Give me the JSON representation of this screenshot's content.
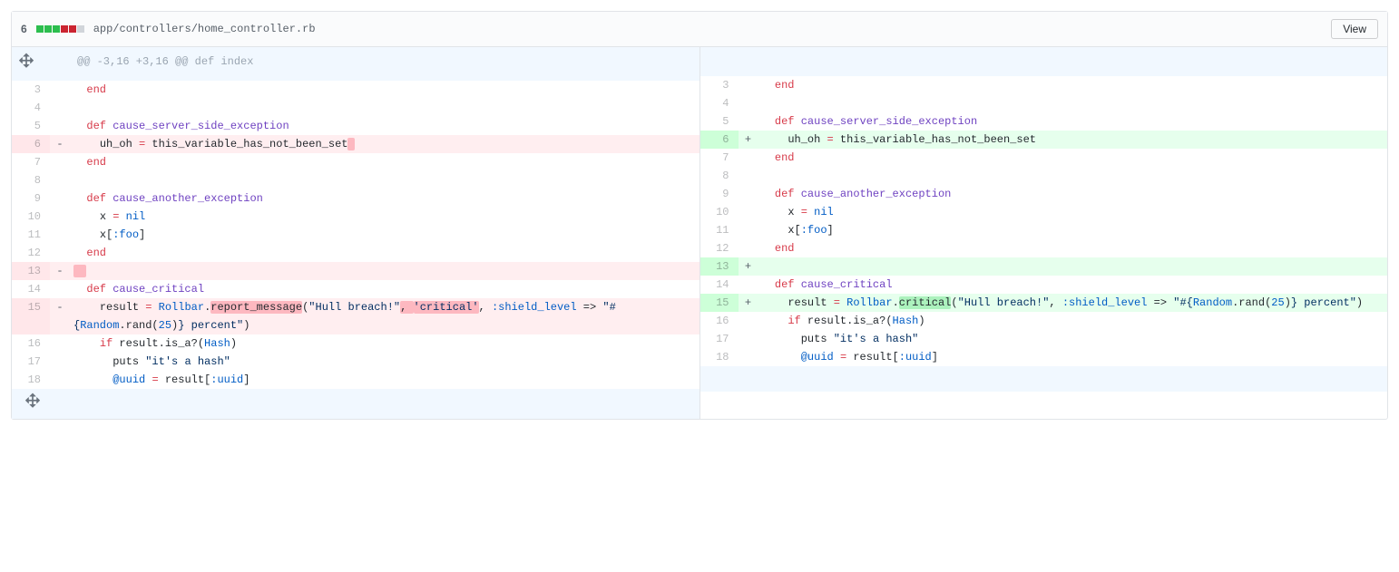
{
  "header": {
    "changed_count": "6",
    "file_path": "app/controllers/home_controller.rb",
    "view_label": "View",
    "diffstat": [
      "a",
      "a",
      "a",
      "d",
      "d",
      "n"
    ]
  },
  "hunk_header": "@@ -3,16 +3,16 @@ def index",
  "left": [
    {
      "n": "3",
      "sign": "",
      "type": "ctx",
      "tokens": [
        {
          "t": "  ",
          "c": ""
        },
        {
          "t": "end",
          "c": "tok-kw"
        }
      ]
    },
    {
      "n": "4",
      "sign": "",
      "type": "ctx",
      "tokens": []
    },
    {
      "n": "5",
      "sign": "",
      "type": "ctx",
      "tokens": [
        {
          "t": "  ",
          "c": ""
        },
        {
          "t": "def",
          "c": "tok-kw"
        },
        {
          "t": " ",
          "c": ""
        },
        {
          "t": "cause_server_side_exception",
          "c": "tok-fn"
        }
      ]
    },
    {
      "n": "6",
      "sign": "-",
      "type": "del",
      "tokens": [
        {
          "t": "    uh_oh ",
          "c": ""
        },
        {
          "t": "=",
          "c": "tok-kw"
        },
        {
          "t": " this_variable_has_not_been_set",
          "c": ""
        },
        {
          "t": " ",
          "c": "mark-del"
        }
      ]
    },
    {
      "n": "7",
      "sign": "",
      "type": "ctx",
      "tokens": [
        {
          "t": "  ",
          "c": ""
        },
        {
          "t": "end",
          "c": "tok-kw"
        }
      ]
    },
    {
      "n": "8",
      "sign": "",
      "type": "ctx",
      "tokens": []
    },
    {
      "n": "9",
      "sign": "",
      "type": "ctx",
      "tokens": [
        {
          "t": "  ",
          "c": ""
        },
        {
          "t": "def",
          "c": "tok-kw"
        },
        {
          "t": " ",
          "c": ""
        },
        {
          "t": "cause_another_exception",
          "c": "tok-fn"
        }
      ]
    },
    {
      "n": "10",
      "sign": "",
      "type": "ctx",
      "tokens": [
        {
          "t": "    x ",
          "c": ""
        },
        {
          "t": "=",
          "c": "tok-kw"
        },
        {
          "t": " ",
          "c": ""
        },
        {
          "t": "nil",
          "c": "tok-num"
        }
      ]
    },
    {
      "n": "11",
      "sign": "",
      "type": "ctx",
      "tokens": [
        {
          "t": "    x[",
          "c": ""
        },
        {
          "t": ":foo",
          "c": "tok-sym"
        },
        {
          "t": "]",
          "c": ""
        }
      ]
    },
    {
      "n": "12",
      "sign": "",
      "type": "ctx",
      "tokens": [
        {
          "t": "  ",
          "c": ""
        },
        {
          "t": "end",
          "c": "tok-kw"
        }
      ]
    },
    {
      "n": "13",
      "sign": "-",
      "type": "del",
      "tokens": [
        {
          "t": "  ",
          "c": "mark-del"
        }
      ]
    },
    {
      "n": "14",
      "sign": "",
      "type": "ctx",
      "tokens": [
        {
          "t": "  ",
          "c": ""
        },
        {
          "t": "def",
          "c": "tok-kw"
        },
        {
          "t": " ",
          "c": ""
        },
        {
          "t": "cause_critical",
          "c": "tok-fn"
        }
      ]
    },
    {
      "n": "15",
      "sign": "-",
      "type": "del",
      "tokens": [
        {
          "t": "    result ",
          "c": ""
        },
        {
          "t": "=",
          "c": "tok-kw"
        },
        {
          "t": " ",
          "c": ""
        },
        {
          "t": "Rollbar",
          "c": "tok-const"
        },
        {
          "t": ".",
          "c": ""
        },
        {
          "t": "report_message",
          "c": "mark-del"
        },
        {
          "t": "(",
          "c": ""
        },
        {
          "t": "\"Hull breach!\"",
          "c": "tok-str"
        },
        {
          "t": ", ",
          "c": "mark-del"
        },
        {
          "t": "'critical'",
          "c": "tok-str mark-del"
        },
        {
          "t": ", ",
          "c": ""
        },
        {
          "t": ":shield_level",
          "c": "tok-sym"
        },
        {
          "t": " => ",
          "c": ""
        },
        {
          "t": "\"#{",
          "c": "tok-str"
        },
        {
          "t": "Random",
          "c": "tok-const"
        },
        {
          "t": ".rand(",
          "c": ""
        },
        {
          "t": "25",
          "c": "tok-num"
        },
        {
          "t": ")",
          "c": ""
        },
        {
          "t": "} percent\"",
          "c": "tok-str"
        },
        {
          "t": ")",
          "c": ""
        }
      ]
    },
    {
      "n": "16",
      "sign": "",
      "type": "ctx",
      "tokens": [
        {
          "t": "    ",
          "c": ""
        },
        {
          "t": "if",
          "c": "tok-kw"
        },
        {
          "t": " result.is_a?(",
          "c": ""
        },
        {
          "t": "Hash",
          "c": "tok-const"
        },
        {
          "t": ")",
          "c": ""
        }
      ]
    },
    {
      "n": "17",
      "sign": "",
      "type": "ctx",
      "tokens": [
        {
          "t": "      puts ",
          "c": ""
        },
        {
          "t": "\"it's a hash\"",
          "c": "tok-str"
        }
      ]
    },
    {
      "n": "18",
      "sign": "",
      "type": "ctx",
      "tokens": [
        {
          "t": "      ",
          "c": ""
        },
        {
          "t": "@uuid",
          "c": "tok-num"
        },
        {
          "t": " ",
          "c": ""
        },
        {
          "t": "=",
          "c": "tok-kw"
        },
        {
          "t": " result[",
          "c": ""
        },
        {
          "t": ":uuid",
          "c": "tok-sym"
        },
        {
          "t": "]",
          "c": ""
        }
      ]
    }
  ],
  "right": [
    {
      "n": "3",
      "sign": "",
      "type": "ctx",
      "tokens": [
        {
          "t": "  ",
          "c": ""
        },
        {
          "t": "end",
          "c": "tok-kw"
        }
      ]
    },
    {
      "n": "4",
      "sign": "",
      "type": "ctx",
      "tokens": []
    },
    {
      "n": "5",
      "sign": "",
      "type": "ctx",
      "tokens": [
        {
          "t": "  ",
          "c": ""
        },
        {
          "t": "def",
          "c": "tok-kw"
        },
        {
          "t": " ",
          "c": ""
        },
        {
          "t": "cause_server_side_exception",
          "c": "tok-fn"
        }
      ]
    },
    {
      "n": "6",
      "sign": "+",
      "type": "add",
      "tokens": [
        {
          "t": "    uh_oh ",
          "c": ""
        },
        {
          "t": "=",
          "c": "tok-kw"
        },
        {
          "t": " this_variable_has_not_been_set",
          "c": ""
        }
      ]
    },
    {
      "n": "7",
      "sign": "",
      "type": "ctx",
      "tokens": [
        {
          "t": "  ",
          "c": ""
        },
        {
          "t": "end",
          "c": "tok-kw"
        }
      ]
    },
    {
      "n": "8",
      "sign": "",
      "type": "ctx",
      "tokens": []
    },
    {
      "n": "9",
      "sign": "",
      "type": "ctx",
      "tokens": [
        {
          "t": "  ",
          "c": ""
        },
        {
          "t": "def",
          "c": "tok-kw"
        },
        {
          "t": " ",
          "c": ""
        },
        {
          "t": "cause_another_exception",
          "c": "tok-fn"
        }
      ]
    },
    {
      "n": "10",
      "sign": "",
      "type": "ctx",
      "tokens": [
        {
          "t": "    x ",
          "c": ""
        },
        {
          "t": "=",
          "c": "tok-kw"
        },
        {
          "t": " ",
          "c": ""
        },
        {
          "t": "nil",
          "c": "tok-num"
        }
      ]
    },
    {
      "n": "11",
      "sign": "",
      "type": "ctx",
      "tokens": [
        {
          "t": "    x[",
          "c": ""
        },
        {
          "t": ":foo",
          "c": "tok-sym"
        },
        {
          "t": "]",
          "c": ""
        }
      ]
    },
    {
      "n": "12",
      "sign": "",
      "type": "ctx",
      "tokens": [
        {
          "t": "  ",
          "c": ""
        },
        {
          "t": "end",
          "c": "tok-kw"
        }
      ]
    },
    {
      "n": "13",
      "sign": "+",
      "type": "add",
      "tokens": []
    },
    {
      "n": "14",
      "sign": "",
      "type": "ctx",
      "tokens": [
        {
          "t": "  ",
          "c": ""
        },
        {
          "t": "def",
          "c": "tok-kw"
        },
        {
          "t": " ",
          "c": ""
        },
        {
          "t": "cause_critical",
          "c": "tok-fn"
        }
      ]
    },
    {
      "n": "15",
      "sign": "+",
      "type": "add",
      "tokens": [
        {
          "t": "    result ",
          "c": ""
        },
        {
          "t": "=",
          "c": "tok-kw"
        },
        {
          "t": " ",
          "c": ""
        },
        {
          "t": "Rollbar",
          "c": "tok-const"
        },
        {
          "t": ".",
          "c": ""
        },
        {
          "t": "critical",
          "c": "mark-add"
        },
        {
          "t": "(",
          "c": ""
        },
        {
          "t": "\"Hull breach!\"",
          "c": "tok-str"
        },
        {
          "t": ", ",
          "c": ""
        },
        {
          "t": ":shield_level",
          "c": "tok-sym"
        },
        {
          "t": " => ",
          "c": ""
        },
        {
          "t": "\"#{",
          "c": "tok-str"
        },
        {
          "t": "Random",
          "c": "tok-const"
        },
        {
          "t": ".rand(",
          "c": ""
        },
        {
          "t": "25",
          "c": "tok-num"
        },
        {
          "t": ")",
          "c": ""
        },
        {
          "t": "} percent\"",
          "c": "tok-str"
        },
        {
          "t": ")",
          "c": ""
        }
      ]
    },
    {
      "n": "16",
      "sign": "",
      "type": "ctx",
      "tokens": [
        {
          "t": "    ",
          "c": ""
        },
        {
          "t": "if",
          "c": "tok-kw"
        },
        {
          "t": " result.is_a?(",
          "c": ""
        },
        {
          "t": "Hash",
          "c": "tok-const"
        },
        {
          "t": ")",
          "c": ""
        }
      ]
    },
    {
      "n": "17",
      "sign": "",
      "type": "ctx",
      "tokens": [
        {
          "t": "      puts ",
          "c": ""
        },
        {
          "t": "\"it's a hash\"",
          "c": "tok-str"
        }
      ]
    },
    {
      "n": "18",
      "sign": "",
      "type": "ctx",
      "tokens": [
        {
          "t": "      ",
          "c": ""
        },
        {
          "t": "@uuid",
          "c": "tok-num"
        },
        {
          "t": " ",
          "c": ""
        },
        {
          "t": "=",
          "c": "tok-kw"
        },
        {
          "t": " result[",
          "c": ""
        },
        {
          "t": ":uuid",
          "c": "tok-sym"
        },
        {
          "t": "]",
          "c": ""
        }
      ]
    }
  ]
}
